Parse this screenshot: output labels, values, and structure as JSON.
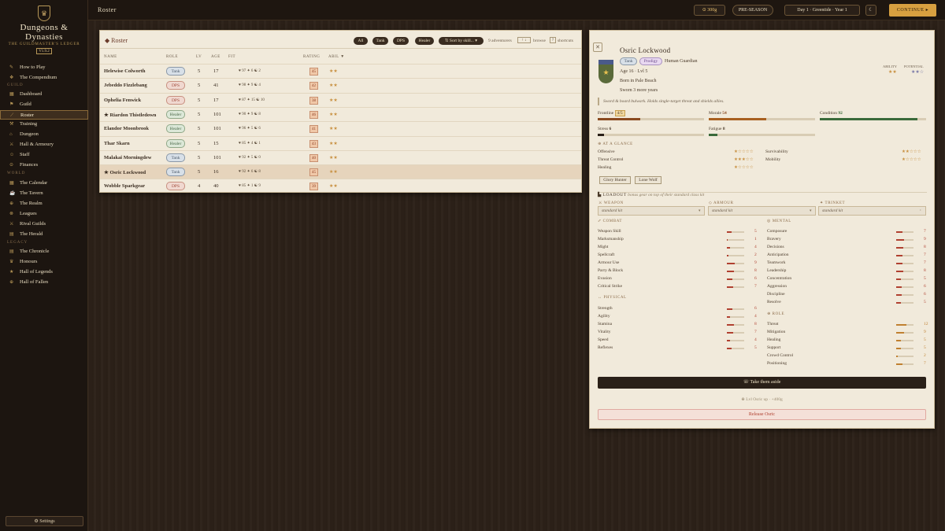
{
  "brand": {
    "title1": "Dungeons &",
    "title2": "Dynasties",
    "subtitle": "THE GUILDMASTER'S LEDGER",
    "version": "V1.9.2"
  },
  "nav": {
    "top": [
      {
        "label": "How to Play",
        "icon": "book-icon"
      },
      {
        "label": "The Compendium",
        "icon": "compendium-icon"
      }
    ],
    "guild_label": "GUILD",
    "guild": [
      {
        "label": "Dashboard",
        "icon": "dashboard-icon"
      },
      {
        "label": "Guild",
        "icon": "guild-icon"
      },
      {
        "label": "Roster",
        "icon": "sword-icon"
      },
      {
        "label": "Training",
        "icon": "training-icon"
      },
      {
        "label": "Dungeon",
        "icon": "dungeon-icon"
      },
      {
        "label": "Hall & Armoury",
        "icon": "armoury-icon"
      },
      {
        "label": "Staff",
        "icon": "staff-icon"
      },
      {
        "label": "Finances",
        "icon": "finances-icon"
      }
    ],
    "world_label": "WORLD",
    "world": [
      {
        "label": "The Calendar",
        "icon": "calendar-icon"
      },
      {
        "label": "The Tavern",
        "icon": "tavern-icon"
      },
      {
        "label": "The Realm",
        "icon": "realm-icon"
      },
      {
        "label": "Leagues",
        "icon": "leagues-icon"
      },
      {
        "label": "Rival Guilds",
        "icon": "rivals-icon"
      },
      {
        "label": "The Herald",
        "icon": "herald-icon"
      }
    ],
    "legacy_label": "LEGACY",
    "legacy": [
      {
        "label": "The Chronicle",
        "icon": "chronicle-icon"
      },
      {
        "label": "Honours",
        "icon": "honours-icon"
      },
      {
        "label": "Hall of Legends",
        "icon": "legends-icon"
      },
      {
        "label": "Hall of Fallen",
        "icon": "fallen-icon"
      }
    ],
    "settings": "⚙ Settings"
  },
  "topbar": {
    "title": "Roster",
    "gold": "⊙ 300g",
    "season": "PRE-SEASON",
    "date": "Day 1 · Greentide · Year 1",
    "continue": "CONTINUE ▸"
  },
  "roster": {
    "title": "◆ Roster",
    "filters": [
      "All",
      "Tank",
      "DPS",
      "Healer"
    ],
    "sort": "⇅ Sort by skill... ▾",
    "count": "9 adventurers",
    "browse": "browse",
    "shortcuts": "shortcuts",
    "headers": {
      "name": "NAME",
      "role": "ROLE",
      "lv": "LV",
      "age": "AGE",
      "fit": "FIT",
      "rating": "RATING",
      "abil": "ABIL ▼"
    },
    "rows": [
      {
        "name": "Helewise Colworth",
        "role": "Tank",
        "lv": "5",
        "age": "17",
        "fit": "♥ 97 ✦ 6 ☯ 2",
        "rating": "45",
        "stars": "★★"
      },
      {
        "name": "Jebeddo Fizzlebang",
        "role": "DPS",
        "lv": "5",
        "age": "41",
        "fit": "♥ 98 ✦ 9 ☯ 4",
        "rating": "42",
        "stars": "★★"
      },
      {
        "name": "Ophelia Fenwick",
        "role": "DPS",
        "lv": "5",
        "age": "17",
        "fit": "♥ 87 ✦ 15 ☯ 10",
        "rating": "38",
        "stars": "★★"
      },
      {
        "name": "★ Riardon Thistledown",
        "role": "Healer",
        "lv": "5",
        "age": "101",
        "fit": "♥ 90 ✦ 9 ☯ 8",
        "rating": "46",
        "stars": "★★"
      },
      {
        "name": "Elandor Moonbrook",
        "role": "Healer",
        "lv": "5",
        "age": "101",
        "fit": "♥ 96 ✦ 5 ☯ 6",
        "rating": "41",
        "stars": "★★"
      },
      {
        "name": "Thar Skarn",
        "role": "Healer",
        "lv": "5",
        "age": "15",
        "fit": "♥ 85 ✦ 4 ☯ 1",
        "rating": "43",
        "stars": "★★"
      },
      {
        "name": "Malakai Morningdew",
        "role": "Tank",
        "lv": "5",
        "age": "101",
        "fit": "♥ 92 ✦ 5 ☯ 0",
        "rating": "40",
        "stars": "★★"
      },
      {
        "name": "★ Osric Lockwood",
        "role": "Tank",
        "lv": "5",
        "age": "16",
        "fit": "♥ 92 ✦ 6 ☯ 8",
        "rating": "45",
        "stars": "★★"
      },
      {
        "name": "Wobble Sparkgear",
        "role": "DPS",
        "lv": "4",
        "age": "40",
        "fit": "♥ 85 ✦ 1 ☯ 9",
        "rating": "39",
        "stars": "★★"
      }
    ]
  },
  "detail": {
    "name": "Osric Lockwood",
    "tags": [
      "Tank",
      "Prodigy"
    ],
    "race": "Human Guardian",
    "age_line": "Age 16 · Lvl 5",
    "born": "Born in Pale Beach",
    "sworn": "Sworn 3 more years",
    "ability_label": "ABILITY",
    "potential_label": "POTENTIAL",
    "ability_stars": "★★",
    "potential_stars": "★★☆",
    "quote": "Sword & board bulwark. Holds single-target threat and shields allies.",
    "frontline_label": "Frontline",
    "frontline_val": "4/5",
    "frontline_pct": 0.4,
    "morale_label": "Morale",
    "morale_val": "54",
    "morale_pct": 0.54,
    "condition_label": "Condition",
    "condition_val": "92",
    "condition_pct": 0.92,
    "stress_label": "Stress",
    "stress_val": "6",
    "stress_pct": 0.06,
    "fatigue_label": "Fatigue",
    "fatigue_val": "8",
    "fatigue_pct": 0.08,
    "glance_title": "⊕ AT A GLANCE",
    "glance_left": [
      {
        "label": "Offensive",
        "stars": "★☆☆☆☆"
      },
      {
        "label": "Threat Control",
        "stars": "★★★☆☆"
      },
      {
        "label": "Healing",
        "stars": "★☆☆☆☆"
      }
    ],
    "glance_right": [
      {
        "label": "Survivability",
        "stars": "★★☆☆☆"
      },
      {
        "label": "Mobility",
        "stars": "★☆☆☆☆"
      }
    ],
    "traits": [
      "Glory Hunter",
      "Lone Wolf"
    ],
    "loadout_title": "▙ LOADOUT",
    "loadout_note": "bonus gear on top of their standard class kit",
    "slots": [
      {
        "label": "⚔ WEAPON",
        "value": "standard kit"
      },
      {
        "label": "◇ ARMOUR",
        "value": "standard kit"
      },
      {
        "label": "✦ TRINKET",
        "value": "standard kit"
      }
    ],
    "combat_title": "⤢ COMBAT",
    "combat": [
      [
        "Weapon Skill",
        "5"
      ],
      [
        "Marksmanship",
        "1"
      ],
      [
        "Might",
        "4"
      ],
      [
        "Spellcraft",
        "2"
      ],
      [
        "Armour Use",
        "9"
      ],
      [
        "Parry & Block",
        "8"
      ],
      [
        "Evasion",
        "6"
      ],
      [
        "Critical Strike",
        "7"
      ]
    ],
    "physical_title": "↔ PHYSICAL",
    "physical": [
      [
        "Strength",
        "6"
      ],
      [
        "Agility",
        "4"
      ],
      [
        "Stamina",
        "8"
      ],
      [
        "Vitality",
        "7"
      ],
      [
        "Speed",
        "4"
      ],
      [
        "Reflexes",
        "5"
      ]
    ],
    "mental_title": "◎ MENTAL",
    "mental": [
      [
        "Composure",
        "7"
      ],
      [
        "Bravery",
        "9"
      ],
      [
        "Decisions",
        "8"
      ],
      [
        "Anticipation",
        "7"
      ],
      [
        "Teamwork",
        "7"
      ],
      [
        "Leadership",
        "8"
      ],
      [
        "Concentration",
        "5"
      ],
      [
        "Aggression",
        "6"
      ],
      [
        "Discipline",
        "6"
      ],
      [
        "Resolve",
        "5"
      ]
    ],
    "role_title": "⊕ ROLE",
    "role": [
      [
        "Threat",
        "12"
      ],
      [
        "Mitigation",
        "9"
      ],
      [
        "Healing",
        "5"
      ],
      [
        "Support",
        "5"
      ],
      [
        "Crowd Control",
        "2"
      ],
      [
        "Positioning",
        "7"
      ]
    ],
    "aside_btn": "☏ Take them aside",
    "lvl_note": "⊕ Lvl Osric up · +400g",
    "release_btn": "Release Osric",
    "colors": {
      "accent": "#d8a040",
      "panel": "#f1eadb",
      "dark": "#2a2018",
      "bar_red": "#b04030"
    }
  }
}
